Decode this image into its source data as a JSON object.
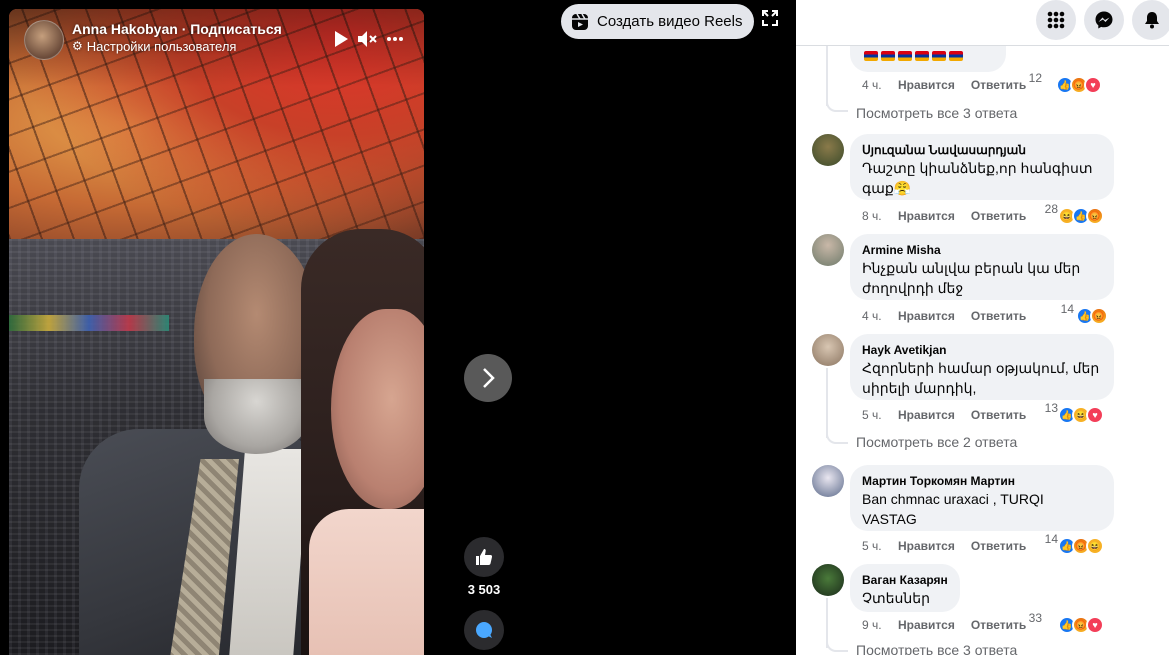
{
  "video": {
    "owner_name": "Anna Hakobyan · Подписаться",
    "owner_sub": "Настройки пользователя"
  },
  "toolbar": {
    "create_reels": "Создать видео Reels"
  },
  "actions": {
    "like_count": "3 503"
  },
  "comments": [
    {
      "name": "Սյուզանա Նավասարդյան",
      "text": "Դաշտը կիանձնեք,որ հանգիստ գաք😤",
      "time": "8 ч.",
      "count": "28"
    },
    {
      "name": "Armine Misha",
      "text": "Ինչքան անլվա բերան կա մեր ժողովրդի մեջ",
      "time": "4 ч.",
      "count": "14"
    },
    {
      "name": "Hayk Avetikjan",
      "text": "Հզորների համար օթյակում, մեր սիրելի մարդիկ,",
      "time": "5 ч.",
      "count": "13"
    },
    {
      "name": "Мартин Торкомян Мартин",
      "text": "Ban chmnac uraxaci , TURQI VASTAG",
      "time": "5 ч.",
      "count": "14"
    },
    {
      "name": "Ваган Казарян",
      "text": "Չտեսներ",
      "time": "9 ч.",
      "count": "33"
    }
  ],
  "top_reply": {
    "time": "4 ч.",
    "count": "12"
  },
  "labels": {
    "like": "Нравится",
    "reply": "Ответить",
    "see_3": "Посмотреть все 3 ответа",
    "see_2": "Посмотреть все 2 ответа",
    "see_3b": "Посмотреть все 3 ответа"
  },
  "colors": {
    "accent": "#1877f2",
    "panel_bg": "#ffffff",
    "bubble_bg": "#f0f2f5"
  }
}
